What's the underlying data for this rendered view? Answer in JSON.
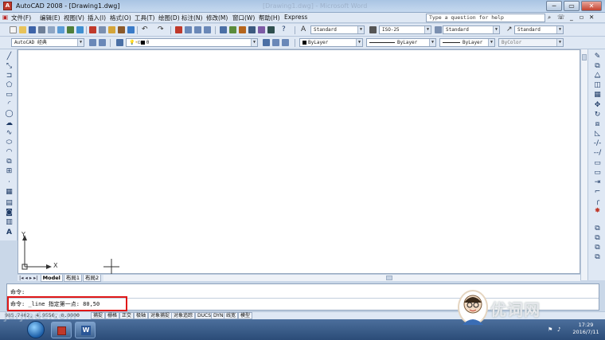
{
  "window": {
    "title": "AutoCAD 2008 - [Drawing1.dwg]",
    "ghost_title": "[Drawing1.dwg] - Microsoft Word",
    "buttons": {
      "minimize": "─",
      "restore": "▭",
      "close": "✕"
    }
  },
  "menubar": {
    "items": [
      "文件(F)",
      "编辑(E)",
      "视图(V)",
      "插入(I)",
      "格式(O)",
      "工具(T)",
      "绘图(D)",
      "标注(N)",
      "修改(M)",
      "窗口(W)",
      "帮助(H)",
      "Express"
    ],
    "help_placeholder": "Type a question for help"
  },
  "toolbar1": {
    "text_style": "Standard",
    "dim_style": "ISO-25",
    "table_style": "Standard",
    "multileader_style": "Standard"
  },
  "toolbar2": {
    "workspace": "AutoCAD 经典",
    "layer": "0",
    "color": "ByLayer",
    "linetype": "ByLayer",
    "lineweight": "ByLayer",
    "plotstyle": "ByColor"
  },
  "ucs": {
    "x_label": "X",
    "y_label": "Y"
  },
  "tabs": {
    "nav": "|◂ ◂ ▸ ▸|",
    "items": [
      "Model",
      "布局1",
      "布局2"
    ]
  },
  "command": {
    "line1": "命令:",
    "line2": "命令: _line 指定第一点: 80,50"
  },
  "status": {
    "coords": "985.7402, 4.9556, 0.0000",
    "buttons": [
      "捕捉",
      "栅格",
      "正交",
      "极轴",
      "对象捕捉",
      "对象追踪",
      "DUCS",
      "DYN",
      "线宽",
      "模型"
    ]
  },
  "taskbar": {
    "time": "17:29",
    "date": "2016/7/11"
  },
  "watermarks": {
    "left": "jurjiade.com",
    "right": "优词网"
  }
}
